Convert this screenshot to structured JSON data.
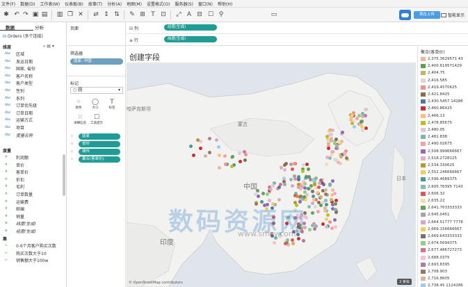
{
  "menu": [
    "文件(F)",
    "数据(D)",
    "工作表(W)",
    "仪表板(B)",
    "故事(T)",
    "分析(A)",
    "地图(M)",
    "设置格式(O)",
    "服务器(S)",
    "窗口(N)",
    "帮助(H)"
  ],
  "upload": {
    "label": "现在上传"
  },
  "smart_show": "智能显示",
  "data_pane": {
    "tab_data": "数据",
    "tab_analysis": "分析",
    "datasource": "Orders (多个连接)",
    "dimensions_header": "维度",
    "dimensions": [
      {
        "type": "Abc",
        "name": "区域"
      },
      {
        "type": "Abc",
        "name": "发运日期"
      },
      {
        "type": "Abc",
        "name": "国家, 省份"
      },
      {
        "type": "Abc",
        "name": "客户名称"
      },
      {
        "type": "Abc",
        "name": "客户类型"
      },
      {
        "type": "Abc",
        "name": "性别"
      },
      {
        "type": "Abc",
        "name": "系列"
      },
      {
        "type": "Abc",
        "name": "订单优先级"
      },
      {
        "type": "Abc",
        "name": "订单日期"
      },
      {
        "type": "Abc",
        "name": "运输方式"
      },
      {
        "type": "Abc",
        "name": "项目"
      },
      {
        "type": "Abc",
        "name": "度量名称"
      }
    ],
    "measures_header": "度量",
    "measures": [
      {
        "type": "#",
        "name": "利润额"
      },
      {
        "type": "#",
        "name": "单价"
      },
      {
        "type": "#",
        "name": "客单价"
      },
      {
        "type": "#",
        "name": "折扣"
      },
      {
        "type": "#",
        "name": "毛利"
      },
      {
        "type": "#",
        "name": "订单数量"
      },
      {
        "type": "#",
        "name": "运输费"
      },
      {
        "type": "#",
        "name": "邮编"
      },
      {
        "type": "#",
        "name": "销量"
      },
      {
        "type": "⊕",
        "name": "纬度(生成)"
      },
      {
        "type": "⊕",
        "name": "经度(生成)"
      }
    ],
    "sets_header": "集",
    "sets": [
      {
        "type": "∞",
        "name": "0-6个月客户购买次数"
      },
      {
        "type": "∞",
        "name": "购买次数大于10"
      },
      {
        "type": "∞",
        "name": "销售额大于100w"
      }
    ]
  },
  "shelves": {
    "pages": "页面",
    "filters": "筛选器",
    "filter_pill": "国家: 中国",
    "marks": "标记",
    "mark_type": "圆",
    "mark_buttons": [
      "颜色",
      "大小",
      "标签",
      "详细信息",
      "工具提示"
    ],
    "mark_pills": [
      "国家",
      "省份",
      "城市",
      "聚合(客单价)"
    ],
    "columns_label": "iii 列",
    "columns_pill": "经度(生成)",
    "rows_label": "≡ 行",
    "rows_pill": "纬度(生成)"
  },
  "view": {
    "title": "创建字段",
    "map_labels": [
      "哈萨克斯坦",
      "蒙古",
      "中国",
      "印度",
      "日本"
    ],
    "attribution": "© OpenStreetMap contributors",
    "marks_info": "2 条标",
    "watermark": "数码资源网",
    "watermark_url": "www.smzy.com"
  },
  "legend": {
    "title": "聚合(客单价)",
    "items": [
      {
        "label": "2,375.3629571 43",
        "color": "#f2b5a0"
      },
      {
        "label": "2,400.619571429",
        "color": "#59a14f"
      },
      {
        "label": "2,404.75",
        "color": "#c9b35b"
      },
      {
        "label": "2,416.585",
        "color": "#d8d8d8"
      },
      {
        "label": "2,419.4570625",
        "color": "#f28e8c"
      },
      {
        "label": "2,421.8425",
        "color": "#8c6d4f"
      },
      {
        "label": "2,430.5457 14286",
        "color": "#4e79a7"
      },
      {
        "label": "2,460.86425",
        "color": "#c9302c"
      },
      {
        "label": "2,466.13",
        "color": "#ffbf80"
      },
      {
        "label": "2,478.85675",
        "color": "#bcbd22"
      },
      {
        "label": "2,480.05",
        "color": "#e0c7d8"
      },
      {
        "label": "2,481.838",
        "color": "#76b7b2"
      },
      {
        "label": "2,490.02675",
        "color": "#ff9da7"
      },
      {
        "label": "2,508.999666667",
        "color": "#9467bd"
      },
      {
        "label": "2,518.2728125",
        "color": "#e1afd1"
      },
      {
        "label": "2,534.330625",
        "color": "#b6992d"
      },
      {
        "label": "2,552.246666667",
        "color": "#f1ce63"
      },
      {
        "label": "2,596.4689375",
        "color": "#499894"
      },
      {
        "label": "2,605.76395 7143",
        "color": "#86bcb6"
      },
      {
        "label": "2,606.32",
        "color": "#e15759"
      },
      {
        "label": "2,635.22",
        "color": "#ffd9a8"
      },
      {
        "label": "2,641.763333333",
        "color": "#6a9f58"
      },
      {
        "label": "2,645.0451",
        "color": "#a5a5a5"
      },
      {
        "label": "2,664.51777 7778",
        "color": "#d4a6c8"
      },
      {
        "label": "2,669.156666667",
        "color": "#f4cc5b"
      },
      {
        "label": "2,669.643333333",
        "color": "#79706e"
      },
      {
        "label": "2,674.5694375",
        "color": "#8cd17d"
      },
      {
        "label": "2,677.486727273",
        "color": "#d37295"
      },
      {
        "label": "2,688.0375",
        "color": "#fabfd2"
      },
      {
        "label": "2,693.8395",
        "color": "#b07aa1"
      },
      {
        "label": "2,708.903",
        "color": "#9d7660"
      },
      {
        "label": "2,716.8605",
        "color": "#d7b5a6"
      },
      {
        "label": "2,738.45 1124286",
        "color": "#a0cbe8"
      }
    ]
  }
}
